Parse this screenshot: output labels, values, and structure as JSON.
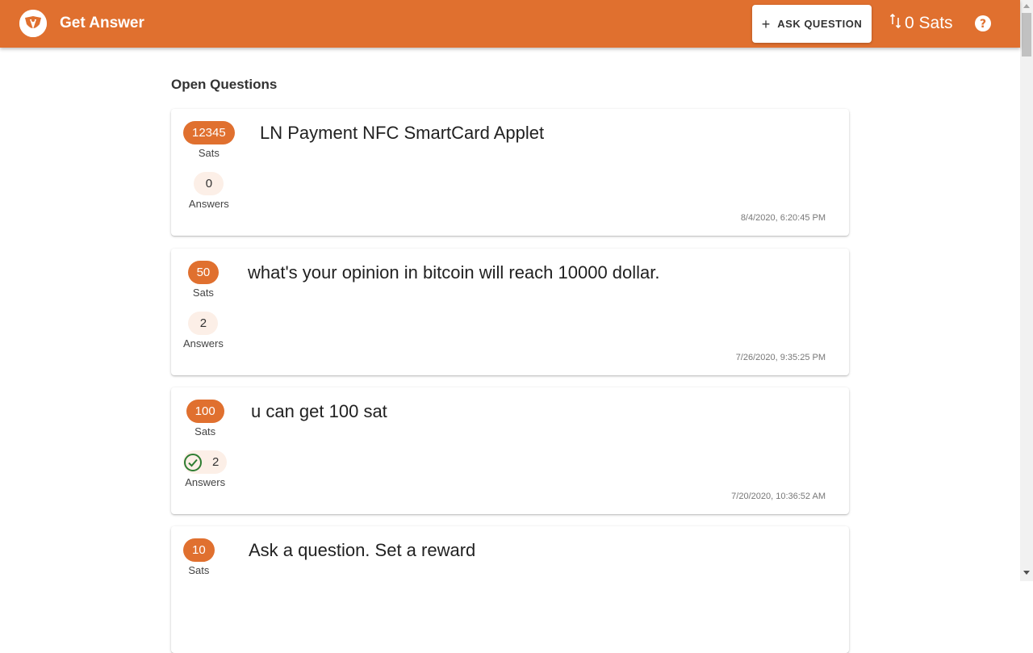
{
  "header": {
    "app_title": "Get Answer",
    "ask_button_label": "ASK QUESTION",
    "balance": "0 Sats",
    "accent_color": "#e0702f",
    "icons": [
      "logo-icon",
      "plus-icon",
      "swap-vert-icon",
      "help-icon"
    ]
  },
  "main": {
    "section_title": "Open Questions",
    "questions": [
      {
        "sats": "12345",
        "sats_label": "Sats",
        "answers": "0",
        "answers_label": "Answers",
        "accepted": false,
        "title": "LN Payment NFC SmartCard Applet",
        "date": "8/4/2020, 6:20:45 PM"
      },
      {
        "sats": "50",
        "sats_label": "Sats",
        "answers": "2",
        "answers_label": "Answers",
        "accepted": false,
        "title": "what's your opinion in bitcoin will reach 10000 dollar.",
        "date": "7/26/2020, 9:35:25 PM"
      },
      {
        "sats": "100",
        "sats_label": "Sats",
        "answers": "2",
        "answers_label": "Answers",
        "accepted": true,
        "title": "u can get 100 sat",
        "date": "7/20/2020, 10:36:52 AM"
      },
      {
        "sats": "10",
        "sats_label": "Sats",
        "title": "Ask a question. Set a reward"
      }
    ]
  }
}
